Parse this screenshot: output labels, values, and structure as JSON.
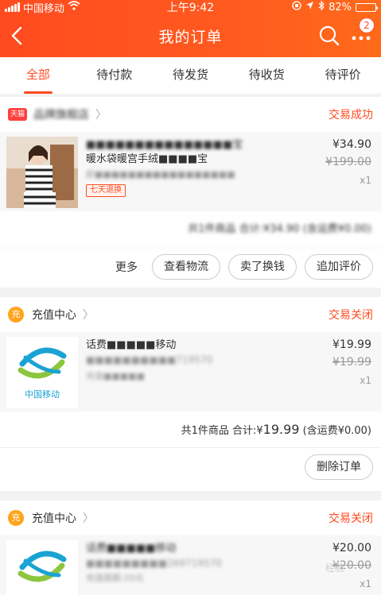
{
  "status_bar": {
    "carrier": "中国移动",
    "time": "上午9:42",
    "battery": "82%"
  },
  "header": {
    "title": "我的订单",
    "badge": "2"
  },
  "tabs": [
    {
      "label": "全部"
    },
    {
      "label": "待付款"
    },
    {
      "label": "待发货"
    },
    {
      "label": "待收货"
    },
    {
      "label": "待评价"
    }
  ],
  "orders": [
    {
      "shop_badge": "天猫",
      "shop_name": "品牌旗舰店",
      "status": "交易成功",
      "item": {
        "name": "暖水袋暖宫手绒充电宝",
        "name_line1": "■■■■■■■■■■■■■■■宝",
        "name_line2": "暖水袋暖宫手绒■■■■宝",
        "sku": "颜■■■■■■■■■■■■■■■■■",
        "tag": "七天退换",
        "price": "¥34.90",
        "old_price": "¥199.00",
        "qty": "x1"
      },
      "summary": "共1件商品 合计:¥34.90 (含运费¥0.00)",
      "actions": {
        "more": "更多",
        "logistics": "查看物流",
        "resell": "卖了换钱",
        "review": "追加评价"
      }
    },
    {
      "shop_name": "充值中心",
      "status": "交易关闭",
      "item": {
        "name_line1": "话费■■■■■移动",
        "name_line2": "■■■■■■■■■■719570",
        "sub": "充值■■■■■",
        "logo_text": "中国移动",
        "price": "¥19.99",
        "old_price": "¥19.99",
        "qty": "x1"
      },
      "summary": {
        "prefix": "共1件商品 合计:¥",
        "total": "19.99",
        "suffix": "(含运费¥0.00)"
      },
      "actions": {
        "delete": "删除订单"
      }
    },
    {
      "shop_name": "充值中心",
      "status": "交易关闭",
      "item": {
        "name_line1": "话费■■■■■移动",
        "name_line2": "■■■■■■■■■269719570",
        "sub": "充值面额:20元",
        "price": "¥20.00",
        "old_price": "¥20.00",
        "qty": "x1"
      }
    }
  ],
  "watermark": "经验"
}
